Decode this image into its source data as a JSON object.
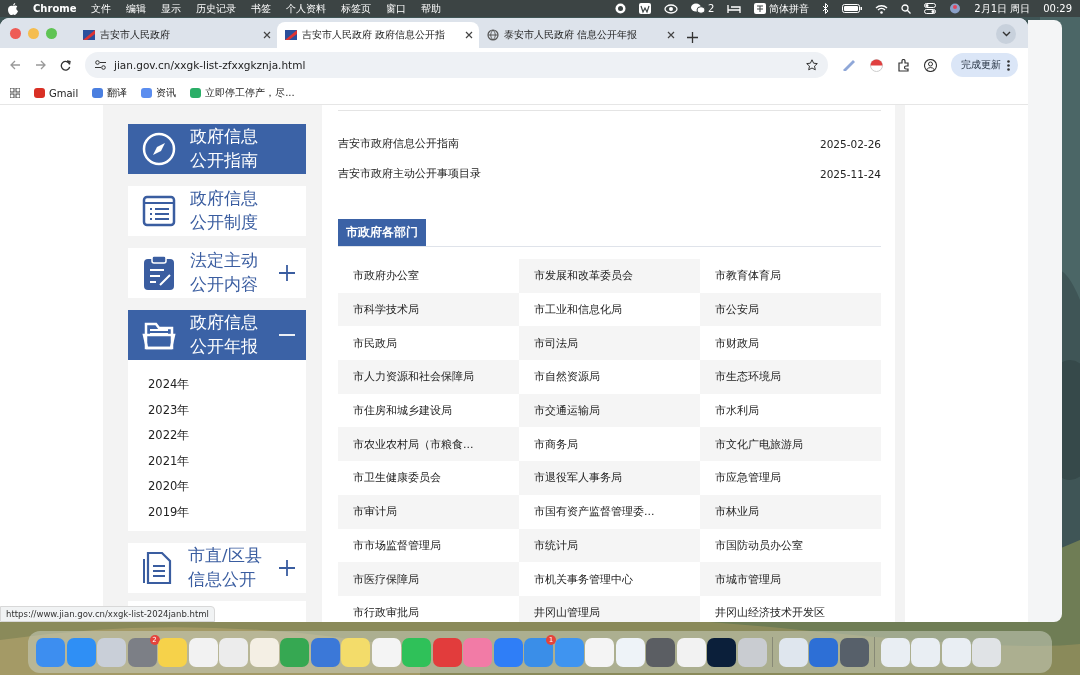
{
  "menu_bar": {
    "app": "Chrome",
    "menus": [
      "文件",
      "编辑",
      "显示",
      "历史记录",
      "书签",
      "个人资料",
      "标签页",
      "窗口",
      "帮助"
    ],
    "wechat_count": "2",
    "input_method": "简体拼音",
    "date": "2月1日 周日",
    "time": "00:29"
  },
  "browser": {
    "tabs": [
      {
        "title": "吉安市人民政府",
        "kind": "flag",
        "selected": false
      },
      {
        "title": "吉安市人民政府 政府信息公开指",
        "kind": "flag",
        "selected": true
      },
      {
        "title": "泰安市人民政府 信息公开年报",
        "kind": "globe",
        "selected": false
      }
    ],
    "address": "jian.gov.cn/xxgk-list-zfxxgkznja.html",
    "update_button": "完成更新",
    "bookmarks": [
      {
        "label": "Gmail",
        "color": "#d93025"
      },
      {
        "label": "翻译",
        "color": "#4a7fe0"
      },
      {
        "label": "资讯",
        "color": "#5b8def"
      },
      {
        "label": "立即停工停产，尽...",
        "color": "#2aae67"
      }
    ],
    "status_url": "https://www.jian.gov.cn/xxgk-list-2024janb.html"
  },
  "sidebar": {
    "items": [
      {
        "kind": "compass",
        "lines": [
          "政府信息",
          "公开指南"
        ],
        "selected": true
      },
      {
        "kind": "list",
        "lines": [
          "政府信息",
          "公开制度"
        ],
        "selected": false
      },
      {
        "kind": "clipboard",
        "lines": [
          "法定主动",
          "公开内容"
        ],
        "selected": false,
        "expanded": false
      },
      {
        "kind": "folder",
        "lines": [
          "政府信息",
          "公开年报"
        ],
        "selected": true,
        "expanded": true,
        "children": [
          {
            "label": "2024年"
          },
          {
            "label": "2023年"
          },
          {
            "label": "2022年"
          },
          {
            "label": "2021年"
          },
          {
            "label": "2020年"
          },
          {
            "label": "2019年"
          }
        ]
      },
      {
        "kind": "document",
        "lines": [
          "市直/区县",
          "信息公开"
        ],
        "selected": false,
        "expanded": false
      }
    ]
  },
  "documents": [
    {
      "title": "吉安市政府信息公开指南",
      "date": "2025-02-26"
    },
    {
      "title": "吉安市政府主动公开事项目录",
      "date": "2025-11-24"
    }
  ],
  "section": {
    "title": "市政府各部门",
    "departments": [
      "市政府办公室",
      "市发展和改革委员会",
      "市教育体育局",
      "市科学技术局",
      "市工业和信息化局",
      "市公安局",
      "市民政局",
      "市司法局",
      "市财政局",
      "市人力资源和社会保障局",
      "市自然资源局",
      "市生态环境局",
      "市住房和城乡建设局",
      "市交通运输局",
      "市水利局",
      "市农业农村局（市粮食...",
      "市商务局",
      "市文化广电旅游局",
      "市卫生健康委员会",
      "市退役军人事务局",
      "市应急管理局",
      "市审计局",
      "市国有资产监督管理委...",
      "市林业局",
      "市市场监督管理局",
      "市统计局",
      "市国防动员办公室",
      "市医疗保障局",
      "市机关事务管理中心",
      "市城市管理局",
      "市行政审批局",
      "井冈山管理局",
      "井冈山经济技术开发区"
    ]
  },
  "dock": {
    "apps": [
      {
        "color": "#3d8ef0"
      },
      {
        "color": "#2f8ff5"
      },
      {
        "color": "#c9cfd8"
      },
      {
        "color": "#7c7f86",
        "badge": "2"
      },
      {
        "color": "#f6d24a"
      },
      {
        "color": "#f2f2f2"
      },
      {
        "color": "#ececec"
      },
      {
        "color": "#f4efe4"
      },
      {
        "color": "#36a852"
      },
      {
        "color": "#3b78d8"
      },
      {
        "color": "#f3dc6a"
      },
      {
        "color": "#f4f4f4"
      },
      {
        "color": "#2fc159"
      },
      {
        "color": "#e23c3c"
      },
      {
        "color": "#f27ba6"
      },
      {
        "color": "#2f7ef7"
      },
      {
        "color": "#3a8ee8",
        "badge": "1"
      },
      {
        "color": "#3f94f0"
      },
      {
        "color": "#f4f4f4"
      },
      {
        "color": "#eef3f8"
      },
      {
        "color": "#5b5e63"
      },
      {
        "color": "#f2f2f2"
      },
      {
        "color": "#0b1f3a"
      },
      {
        "color": "#c9ccd1"
      },
      {
        "color": "#dfe6ee"
      },
      {
        "color": "#2d6fd6"
      },
      {
        "color": "#57606a"
      },
      {
        "color": "#e9eef3"
      },
      {
        "color": "#e9eef3"
      },
      {
        "color": "#e9eef3"
      },
      {
        "color": "#e0e3e6"
      }
    ]
  }
}
